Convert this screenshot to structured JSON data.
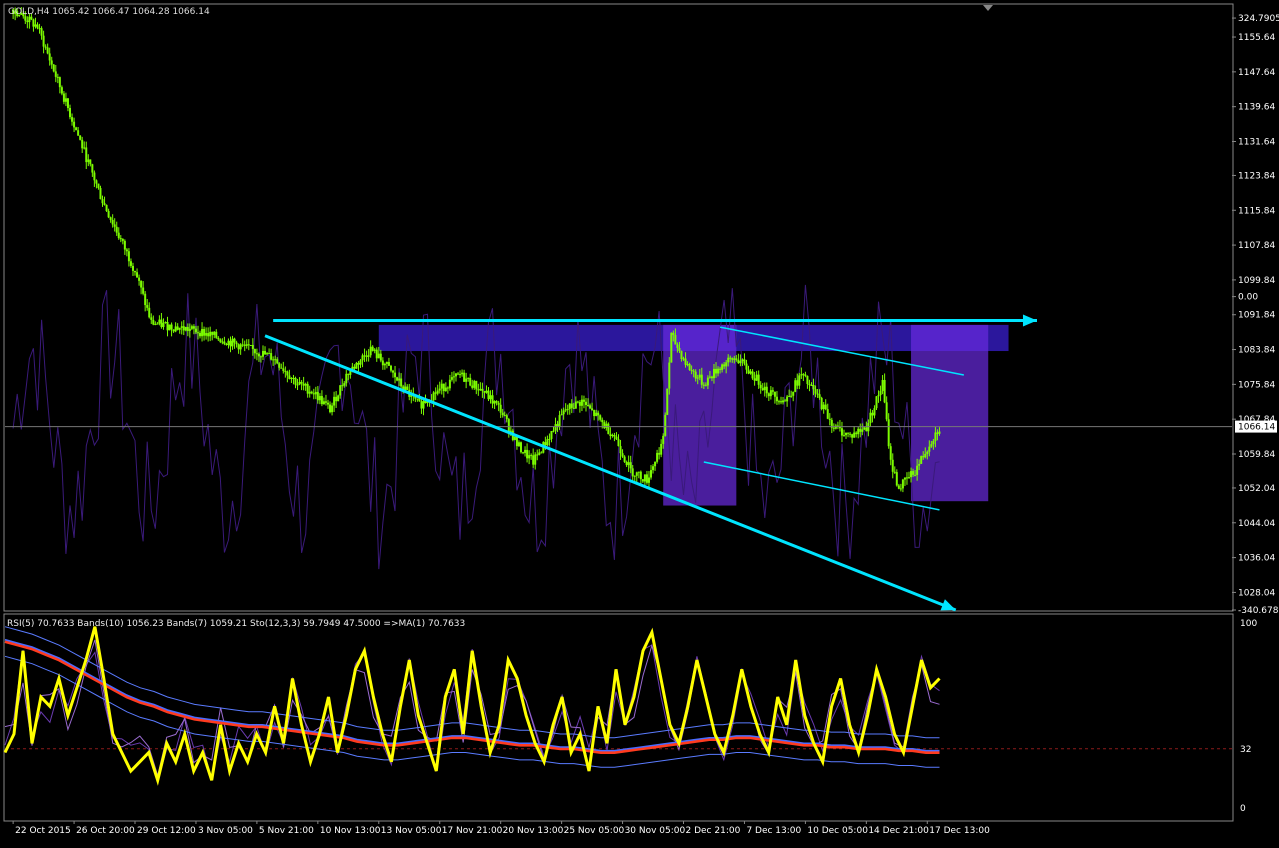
{
  "header": {
    "symbol_text": "GOLD,H4 1065.42 1066.47 1064.28 1066.14",
    "indicator_text": "RSI(5) 70.7633  Bands(10) 1056.23  Bands(7) 1059.21  Sto(12,3,3) 59.7949 47.5000  =>MA(1) 70.7633"
  },
  "colors": {
    "background": "#000000",
    "bull_candle": "#7CFC00",
    "trend_line": "#00E5FF",
    "zone": "#3A1FD0",
    "zone_alt": "#6A2BE0",
    "secondary_line": "#3A1A7A",
    "rsi_yellow": "#FFFF00",
    "ma_red": "#FF3B1F",
    "ma_blue": "#4A6BFF",
    "price_tag_bg": "#FFFFFF"
  },
  "chart_data": [
    {
      "type": "candlestick",
      "price_axis_labels": [
        "324.7905",
        "1155.64",
        "1147.64",
        "1139.64",
        "1131.64",
        "1123.84",
        "1115.84",
        "1107.84",
        "1099.84",
        "0.00",
        "1091.84",
        "1083.84",
        "1075.84",
        "1067.84",
        "1059.84",
        "1052.04",
        "1044.04",
        "1036.04",
        "1028.04",
        "-340.6785"
      ],
      "price_axis_values": [
        1160,
        1155.64,
        1147.64,
        1139.64,
        1131.64,
        1123.84,
        1115.84,
        1107.84,
        1099.84,
        1096,
        1091.84,
        1083.84,
        1075.84,
        1067.84,
        1059.84,
        1052.04,
        1044.04,
        1036.04,
        1028.04,
        1024
      ],
      "current_price": "1066.14",
      "current_price_value": 1066.14,
      "ylim": [
        1024,
        1163
      ],
      "close_path": [
        [
          0,
          1162
        ],
        [
          6,
          1158
        ],
        [
          10,
          1148
        ],
        [
          14,
          1138
        ],
        [
          18,
          1128
        ],
        [
          22,
          1118
        ],
        [
          26,
          1110
        ],
        [
          30,
          1102
        ],
        [
          34,
          1090
        ],
        [
          40,
          1089
        ],
        [
          46,
          1088
        ],
        [
          52,
          1086
        ],
        [
          58,
          1084
        ],
        [
          64,
          1082
        ],
        [
          70,
          1076
        ],
        [
          74,
          1074
        ],
        [
          78,
          1070
        ],
        [
          82,
          1078
        ],
        [
          88,
          1084
        ],
        [
          92,
          1080
        ],
        [
          96,
          1075
        ],
        [
          100,
          1071
        ],
        [
          104,
          1074
        ],
        [
          110,
          1078
        ],
        [
          116,
          1074
        ],
        [
          120,
          1070
        ],
        [
          124,
          1062
        ],
        [
          128,
          1058
        ],
        [
          132,
          1064
        ],
        [
          136,
          1070
        ],
        [
          140,
          1072
        ],
        [
          144,
          1068
        ],
        [
          148,
          1064
        ],
        [
          152,
          1056
        ],
        [
          156,
          1054
        ],
        [
          160,
          1063
        ],
        [
          162,
          1087
        ],
        [
          166,
          1080
        ],
        [
          170,
          1076
        ],
        [
          174,
          1080
        ],
        [
          178,
          1082
        ],
        [
          182,
          1078
        ],
        [
          186,
          1074
        ],
        [
          190,
          1072
        ],
        [
          194,
          1078
        ],
        [
          198,
          1073
        ],
        [
          202,
          1066
        ],
        [
          206,
          1064
        ],
        [
          210,
          1066
        ],
        [
          214,
          1076
        ],
        [
          216,
          1058
        ],
        [
          218,
          1052
        ],
        [
          222,
          1056
        ],
        [
          226,
          1063
        ],
        [
          228,
          1066
        ]
      ],
      "x_axis_labels": [
        "22 Oct 2015",
        "26 Oct 20:00",
        "29 Oct 12:00",
        "3 Nov 05:00",
        "5 Nov 21:00",
        "10 Nov 13:00",
        "13 Nov 05:00",
        "17 Nov 21:00",
        "20 Nov 13:00",
        "25 Nov 05:00",
        "30 Nov 05:00",
        "2 Dec 21:00",
        "7 Dec 13:00",
        "10 Dec 05:00",
        "14 Dec 21:00",
        "17 Dec 13:00"
      ],
      "x_axis_positions": [
        0,
        15,
        30,
        45,
        60,
        75,
        90,
        105,
        120,
        135,
        150,
        165,
        180,
        195,
        210,
        225
      ],
      "x_range": [
        -2,
        300
      ],
      "horizontal_line": 1091,
      "trend_lines": [
        {
          "name": "resistance",
          "from": [
            64,
            1090.5
          ],
          "to": [
            252,
            1090.5
          ],
          "arrow": true
        },
        {
          "name": "lower-channel",
          "from": [
            62,
            1087
          ],
          "to": [
            232,
            1024
          ],
          "arrow": true
        },
        {
          "name": "upper-wedge",
          "from": [
            174,
            1089
          ],
          "to": [
            234,
            1078
          ]
        },
        {
          "name": "lower-wedge",
          "from": [
            170,
            1058
          ],
          "to": [
            228,
            1047
          ]
        }
      ],
      "zones": [
        {
          "from_x": 90,
          "to_x": 245,
          "from_y": 1083.5,
          "to_y": 1089.5
        },
        {
          "from_x": 160,
          "to_x": 178,
          "from_y": 1048,
          "to_y": 1089.5
        },
        {
          "from_x": 221,
          "to_x": 240,
          "from_y": 1049,
          "to_y": 1089.5
        }
      ]
    },
    {
      "type": "line",
      "indicator": "RSI",
      "y_axis_labels": [
        "100",
        "32",
        "0"
      ],
      "y_axis_values": [
        100,
        32,
        0
      ],
      "ylim": [
        0,
        100
      ],
      "level_line": 32,
      "rsi_values": [
        30,
        40,
        85,
        35,
        60,
        55,
        70,
        50,
        65,
        80,
        98,
        70,
        40,
        30,
        20,
        25,
        30,
        15,
        35,
        25,
        40,
        20,
        30,
        15,
        45,
        20,
        35,
        25,
        40,
        30,
        55,
        35,
        70,
        45,
        25,
        40,
        60,
        30,
        50,
        75,
        85,
        60,
        40,
        25,
        55,
        80,
        50,
        35,
        20,
        60,
        75,
        40,
        85,
        55,
        30,
        45,
        80,
        70,
        50,
        35,
        25,
        45,
        60,
        30,
        40,
        20,
        55,
        35,
        75,
        45,
        60,
        85,
        95,
        70,
        45,
        35,
        55,
        80,
        60,
        40,
        30,
        50,
        75,
        55,
        40,
        30,
        60,
        45,
        80,
        50,
        35,
        25,
        55,
        70,
        45,
        30,
        50,
        75,
        60,
        40,
        30,
        55,
        80,
        65,
        70
      ],
      "ma_values": [
        90,
        88,
        86,
        83,
        80,
        76,
        72,
        68,
        64,
        60,
        57,
        55,
        52,
        50,
        48,
        47,
        46,
        45,
        44,
        44,
        43,
        42,
        41,
        40,
        39,
        38,
        36,
        35,
        34,
        34,
        35,
        36,
        37,
        38,
        38,
        37,
        36,
        35,
        34,
        34,
        33,
        32,
        32,
        31,
        30,
        30,
        31,
        32,
        33,
        34,
        35,
        36,
        37,
        37,
        38,
        38,
        37,
        36,
        35,
        34,
        34,
        33,
        33,
        32,
        32,
        32,
        31,
        31,
        30,
        30
      ]
    }
  ]
}
